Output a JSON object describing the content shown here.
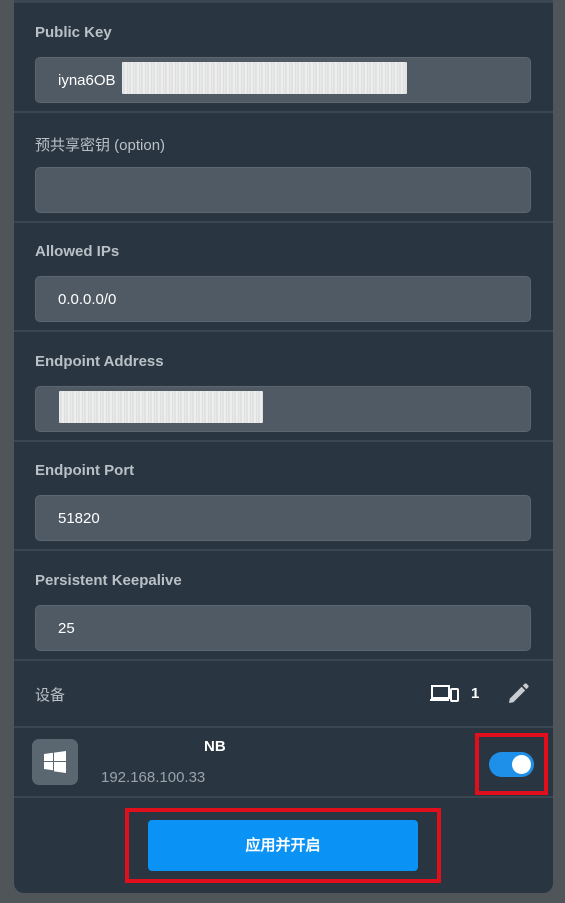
{
  "fields": [
    {
      "label": "Public Key",
      "value": "iyna6OB"
    },
    {
      "label": "预共享密钥 (option)",
      "value": ""
    },
    {
      "label": "Allowed IPs",
      "value": "0.0.0.0/0"
    },
    {
      "label": "Endpoint Address",
      "value": ""
    },
    {
      "label": "Endpoint Port",
      "value": "51820"
    },
    {
      "label": "Persistent Keepalive",
      "value": "25"
    }
  ],
  "devices": {
    "label": "设备",
    "count": "1",
    "count_icon": "devices-icon",
    "edit_icon": "pencil-icon",
    "items": [
      {
        "name": "NB",
        "ip": "192.168.100.33",
        "os_icon": "windows-icon",
        "enabled": true
      }
    ]
  },
  "apply_button": {
    "label": "应用并开启"
  },
  "colors": {
    "panel_bg": "#293540",
    "input_bg": "#4f5a64",
    "accent": "#0a92f4",
    "toggle_on": "#1e90ea",
    "highlight": "#e10e1b"
  }
}
